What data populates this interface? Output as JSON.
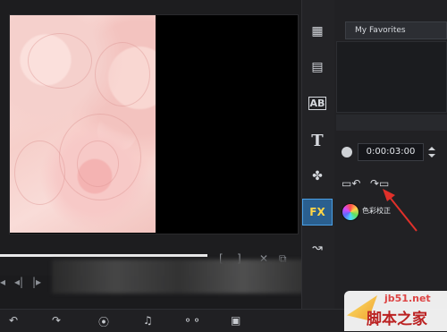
{
  "options": {
    "favorites_label": "My Favorites",
    "duration_value": "0:00:03:00",
    "color_correction_label": "色彩校正"
  },
  "tools": [
    {
      "name": "media-tool",
      "icon": "film-strip-icon"
    },
    {
      "name": "instant-project-tool",
      "icon": "film-magic-icon"
    },
    {
      "name": "transition-tool",
      "icon": "ab-icon",
      "label": "AB"
    },
    {
      "name": "title-tool",
      "icon": "title-t-icon",
      "label": "T"
    },
    {
      "name": "graphic-tool",
      "icon": "puzzle-icon"
    },
    {
      "name": "filter-tool",
      "icon": "fx-icon",
      "label": "FX"
    },
    {
      "name": "path-tool",
      "icon": "motion-path-icon"
    }
  ],
  "trim_controls": {
    "mark_in": "[",
    "mark_out": "]",
    "split": "✕",
    "copy": "⧉"
  },
  "watermark": {
    "domain": "jb51.net",
    "site_cn": "脚本之家"
  },
  "colors": {
    "accent_fx_bg": "#2a5f8f",
    "fx_text": "#ffd646",
    "arrow": "#e0302a"
  }
}
